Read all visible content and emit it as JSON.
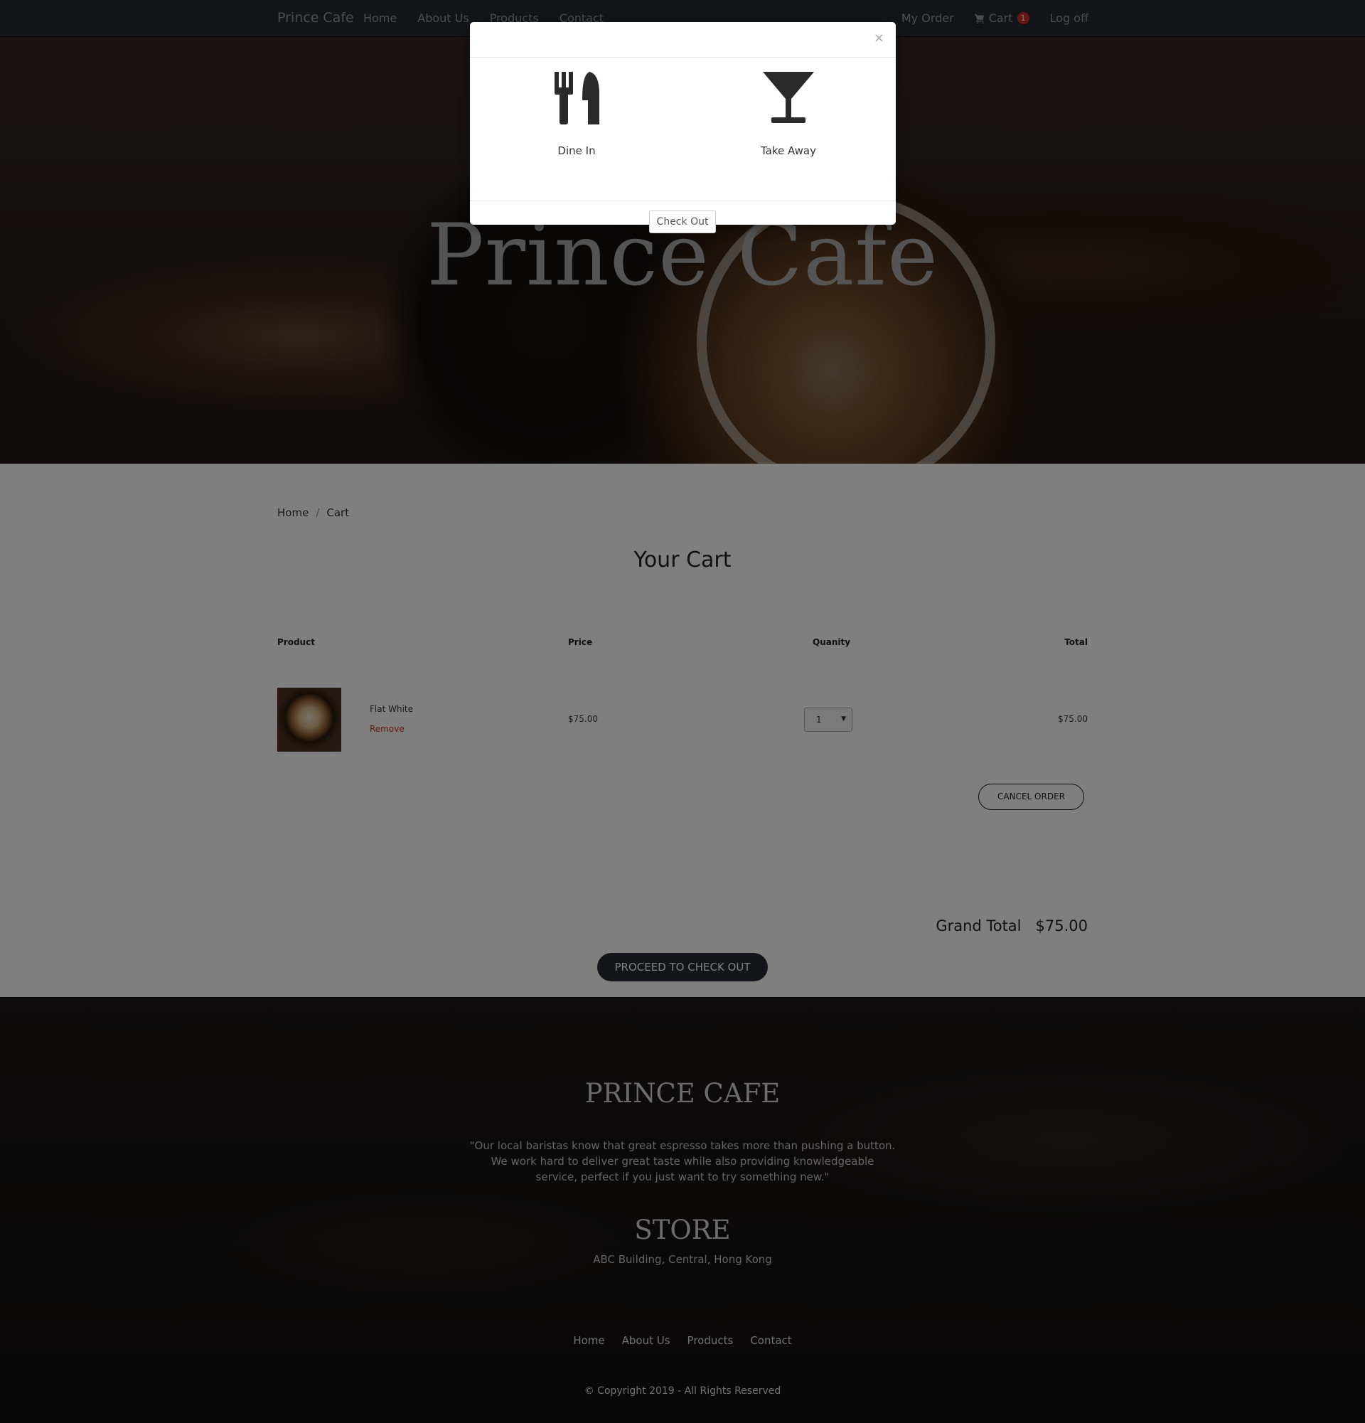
{
  "nav": {
    "brand": "Prince Cafe",
    "links": [
      "Home",
      "About Us",
      "Products",
      "Contact"
    ],
    "right": {
      "my_order": "My Order",
      "cart": "Cart",
      "cart_count": "1",
      "logoff": "Log off"
    }
  },
  "hero": {
    "title": "Prince Cafe"
  },
  "breadcrumb": [
    "Home",
    "Cart"
  ],
  "cart": {
    "title": "Your Cart",
    "headers": {
      "product": "Product",
      "price": "Price",
      "quantity": "Quanity",
      "total": "Total"
    },
    "item": {
      "name": "Flat White",
      "remove": "Remove",
      "price": "$75.00",
      "quantity": "1",
      "total": "$75.00"
    },
    "cancel_label": "CANCEL ORDER",
    "grand_total_label": "Grand Total",
    "grand_total_value": "$75.00",
    "proceed_label": "PROCEED TO CHECK OUT"
  },
  "footer": {
    "title": "PRINCE CAFE",
    "quote": "\"Our local baristas know that great espresso takes more than pushing a button. We work hard to deliver great taste while also providing knowledgeable service, perfect if you just want to try something new.\"",
    "store_title": "STORE",
    "address": "ABC Building, Central, Hong Kong",
    "links": [
      "Home",
      "About Us",
      "Products",
      "Contact"
    ],
    "copyright": "© Copyright 2019 - All Rights Reserved"
  },
  "modal": {
    "close_symbol": "×",
    "options": [
      {
        "label": "Dine In",
        "icon": "utensils-icon"
      },
      {
        "label": "Take Away",
        "icon": "cocktail-glass-icon"
      }
    ],
    "checkout_label": "Check Out"
  },
  "colors": {
    "navbar": "#262a33",
    "accent_red": "#c9302c",
    "button_dark": "#262a33"
  }
}
